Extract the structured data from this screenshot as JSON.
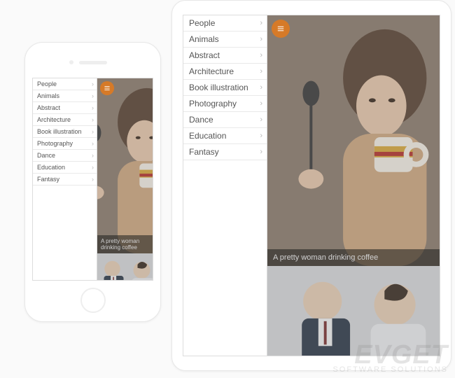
{
  "menu": {
    "items": [
      {
        "label": "People"
      },
      {
        "label": "Animals"
      },
      {
        "label": "Abstract"
      },
      {
        "label": "Architecture"
      },
      {
        "label": "Book illustration"
      },
      {
        "label": "Photography"
      },
      {
        "label": "Dance"
      },
      {
        "label": "Education"
      },
      {
        "label": "Fantasy"
      }
    ]
  },
  "colors": {
    "accent": "#d67a28"
  },
  "gallery": {
    "items": [
      {
        "caption": "A pretty woman drinking coffee"
      },
      {
        "caption": ""
      }
    ]
  },
  "watermark": {
    "brand": "EVGET",
    "tagline": "SOFTWARE SOLUTIONS"
  }
}
